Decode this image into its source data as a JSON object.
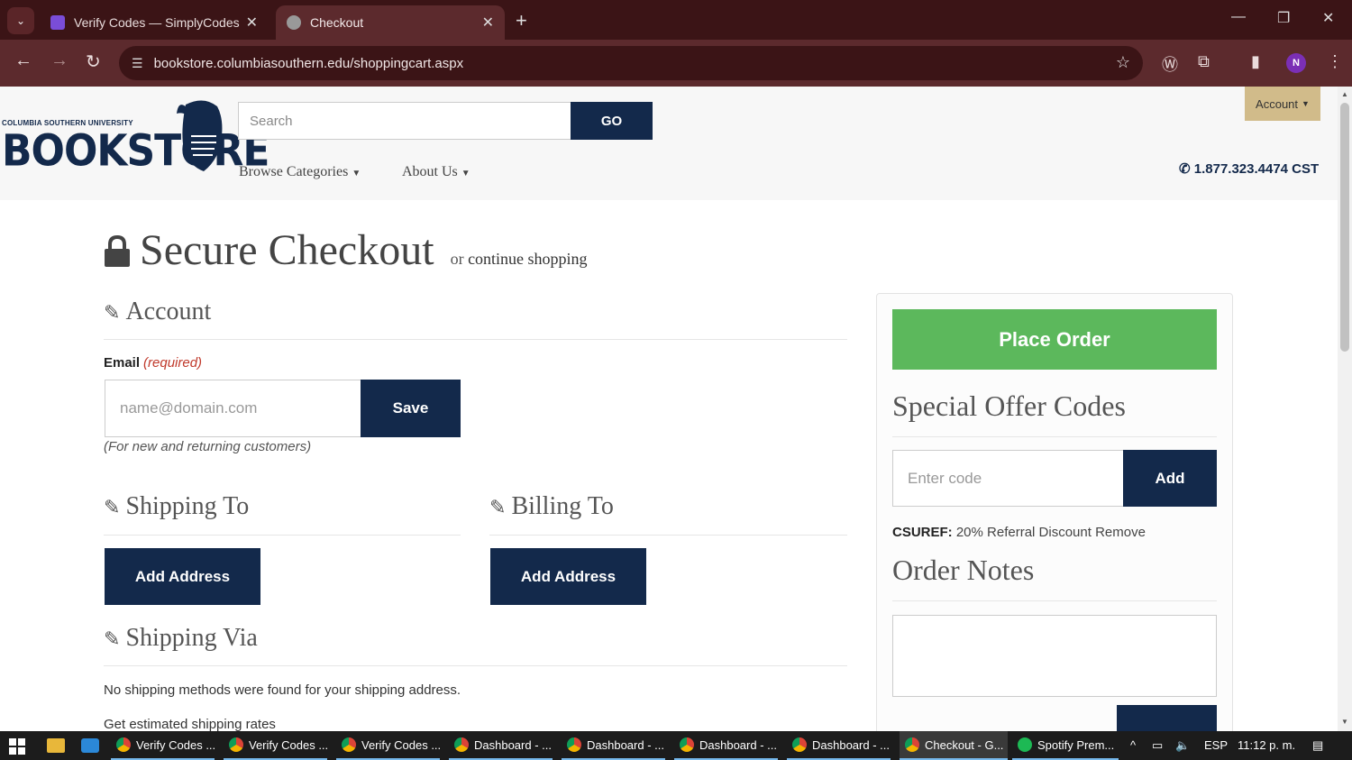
{
  "browser": {
    "tabs": [
      {
        "title": "Verify Codes — SimplyCodes",
        "active": false
      },
      {
        "title": "Checkout",
        "active": true
      }
    ],
    "url": "bookstore.columbiasouthern.edu/shoppingcart.aspx",
    "profile_initial": "N"
  },
  "header": {
    "logo_small": "COLUMBIA SOUTHERN UNIVERSITY",
    "logo_big": "BOOKSTORE",
    "search_placeholder": "Search",
    "go_label": "GO",
    "menu": [
      "Browse Categories",
      "About Us"
    ],
    "account_label": "Account",
    "phone": "1.877.323.4474 CST"
  },
  "checkout": {
    "title": "Secure Checkout",
    "continue_prefix": "or",
    "continue_link": "continue shopping",
    "account_heading": "Account",
    "email_label": "Email",
    "email_required": "(required)",
    "email_placeholder": "name@domain.com",
    "save_label": "Save",
    "email_note": "(For new and returning customers)",
    "shipping_heading": "Shipping To",
    "billing_heading": "Billing To",
    "add_address_label": "Add Address",
    "shipping_via_heading": "Shipping Via",
    "no_shipping_text": "No shipping methods were found for your shipping address.",
    "estimate_text": "Get estimated shipping rates"
  },
  "sidebar": {
    "place_order_label": "Place Order",
    "offer_heading": "Special Offer Codes",
    "code_placeholder": "Enter code",
    "add_label": "Add",
    "promo_code": "CSUREF:",
    "promo_desc": "20% Referral Discount",
    "promo_remove": "Remove",
    "notes_heading": "Order Notes"
  },
  "taskbar": {
    "items": [
      "Verify Codes ...",
      "Verify Codes ...",
      "Verify Codes ...",
      "Dashboard - ...",
      "Dashboard - ...",
      "Dashboard - ...",
      "Dashboard - ...",
      "Checkout - G...",
      "Spotify Prem..."
    ],
    "lang": "ESP",
    "time": "11:12 p. m."
  },
  "colors": {
    "navy": "#13294b",
    "green": "#5cb85c",
    "gold": "#d1bb8a",
    "required_red": "#c0392b"
  }
}
